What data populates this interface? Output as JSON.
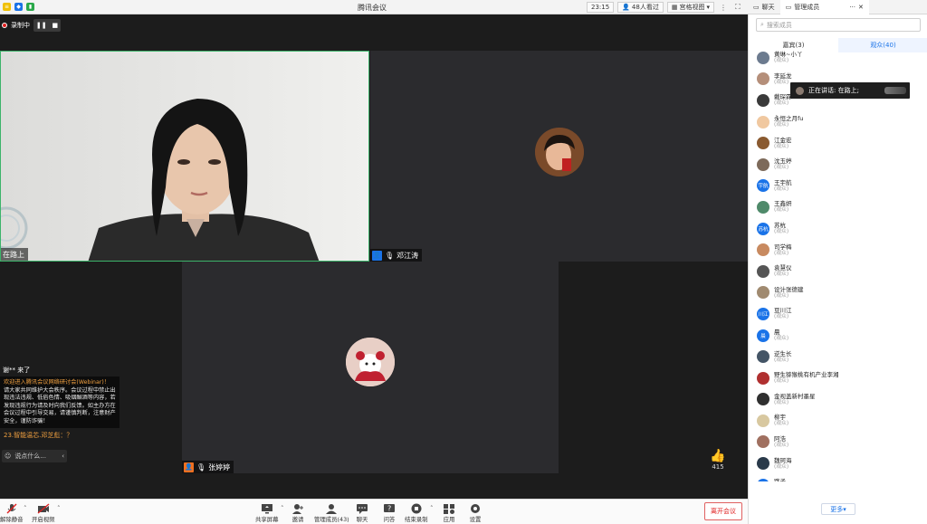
{
  "window": {
    "title": "腾讯会议"
  },
  "titlebar": {
    "time": "23:15",
    "participants": "48人看过",
    "view_mode": "宫格视图"
  },
  "side_tabs": [
    {
      "label": "聊天"
    },
    {
      "label": "管理成员"
    }
  ],
  "recording": {
    "label": "录制中"
  },
  "tiles": [
    {
      "name": "在路上"
    },
    {
      "name": "邓江涛"
    },
    {
      "name": "张婷婷"
    }
  ],
  "chat": {
    "join": "谢** 来了",
    "welcome_title": "欢迎进入腾讯会议网络研讨会(Webinar)！",
    "welcome_body": "请大家共同维护大会秩序。会议过程中禁止出现违法违规、低俗色情、吸烟酗酒等内容，若发现违规行为请及时向我们反馈。如主办方在会议过程中引导交易，请谨慎判断，注意财产安全，谨防诈骗！",
    "question": "23.智能温芯.邓芝彪：？",
    "input_placeholder": "说点什么..."
  },
  "like": {
    "count": "415"
  },
  "toolbar": {
    "unmute": "解除静音",
    "start_video": "开启视频",
    "share": "共享屏幕",
    "invite": "邀请",
    "members": "管理成员(43)",
    "chat": "聊天",
    "qa": "问答",
    "stop_record": "结束录制",
    "apps": "应用",
    "settings": "设置",
    "leave": "离开会议"
  },
  "side": {
    "search_placeholder": "搜索成员",
    "tab_guests": "嘉宾(3)",
    "tab_audience": "观众(40)",
    "speaking": "正在讲话: 在路上;",
    "more": "更多",
    "members": [
      {
        "name": "黄琳~小丫",
        "role": "(观众)",
        "color": "#6c7b8f",
        "initials": ""
      },
      {
        "name": "李延龙",
        "role": "(观众)",
        "color": "#b58f7a",
        "initials": ""
      },
      {
        "name": "戴琛霖",
        "role": "(观众)",
        "color": "#3a3a3a",
        "initials": ""
      },
      {
        "name": "永恒之月fu",
        "role": "(观众)",
        "color": "#f0c8a0",
        "initials": ""
      },
      {
        "name": "江金宏",
        "role": "(观众)",
        "color": "#8a5a30",
        "initials": ""
      },
      {
        "name": "沈玉婷",
        "role": "(观众)",
        "color": "#7d6a5a",
        "initials": ""
      },
      {
        "name": "王宇航",
        "role": "(观众)",
        "color": "#1a73e8",
        "initials": "宇航"
      },
      {
        "name": "王鑫妍",
        "role": "(观众)",
        "color": "#4f8a6a",
        "initials": ""
      },
      {
        "name": "苏杭",
        "role": "(观众)",
        "color": "#1a73e8",
        "initials": "苏杭"
      },
      {
        "name": "司学梅",
        "role": "(观众)",
        "color": "#c88a60",
        "initials": ""
      },
      {
        "name": "袁慧仪",
        "role": "(观众)",
        "color": "#555555",
        "initials": ""
      },
      {
        "name": "设计张德建",
        "role": "(观众)",
        "color": "#a08a70",
        "initials": ""
      },
      {
        "name": "豆川江",
        "role": "(观众)",
        "color": "#1a73e8",
        "initials": "川江"
      },
      {
        "name": "晨",
        "role": "(观众)",
        "color": "#1a73e8",
        "initials": "晨"
      },
      {
        "name": "逆生长",
        "role": "(观众)",
        "color": "#445566",
        "initials": ""
      },
      {
        "name": "野生猕猴桃有机产业李湘",
        "role": "(观众)",
        "color": "#b03030",
        "initials": ""
      },
      {
        "name": "金视盖新村墨星",
        "role": "(观众)",
        "color": "#303030",
        "initials": ""
      },
      {
        "name": "柳宇",
        "role": "(观众)",
        "color": "#d8c8a0",
        "initials": ""
      },
      {
        "name": "阿浩",
        "role": "(观众)",
        "color": "#a07060",
        "initials": ""
      },
      {
        "name": "魏珂海",
        "role": "(观众)",
        "color": "#2a3a4a",
        "initials": ""
      },
      {
        "name": "路子",
        "role": "(观众)",
        "color": "#1a73e8",
        "initials": "路子"
      }
    ]
  },
  "colors": {
    "accent": "#1a73e8",
    "active_border": "#3cb46a",
    "danger": "#e02020"
  }
}
